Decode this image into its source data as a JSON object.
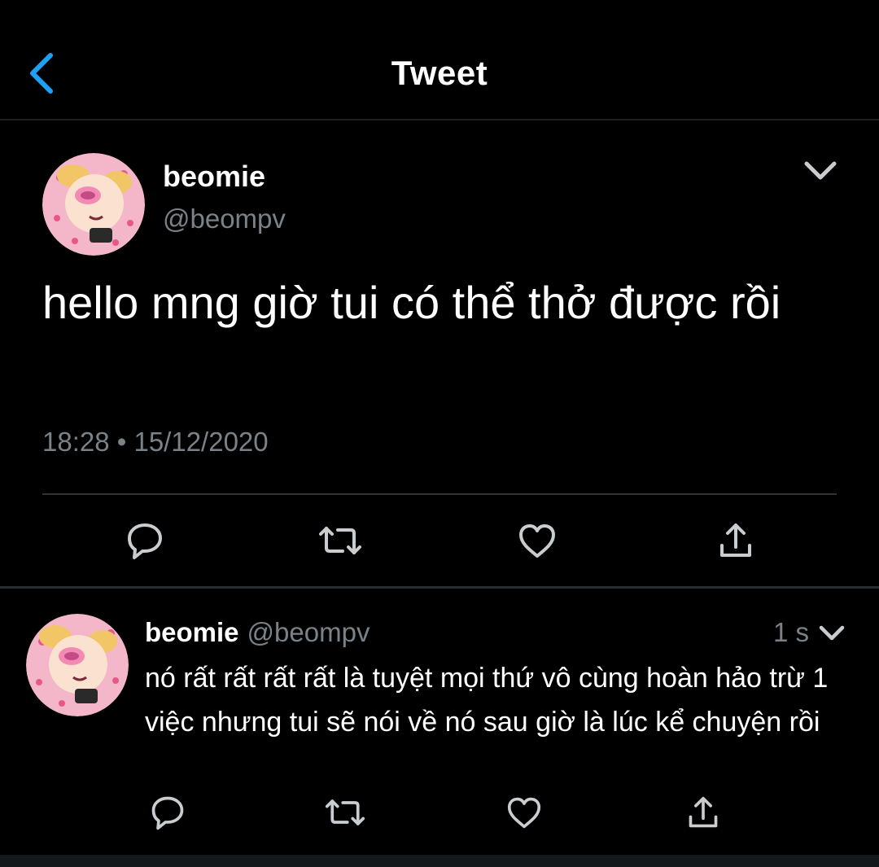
{
  "header": {
    "title": "Tweet",
    "back_icon": "chevron-left-icon",
    "accent_color": "#1da1f2"
  },
  "main_tweet": {
    "author_name": "beomie",
    "author_handle": "@beompv",
    "text": "hello mng giờ tui có thể thở được rồi",
    "timestamp": "18:28 • 15/12/2020",
    "actions": [
      "reply-icon",
      "retweet-icon",
      "like-icon",
      "share-icon"
    ]
  },
  "reply": {
    "author_name": "beomie",
    "author_handle": "@beompv",
    "time_ago": "1 s",
    "text": "nó rất rất rất rất là tuyệt mọi thứ vô cùng hoàn hảo trừ 1 việc nhưng tui sẽ nói về nó sau giờ là lúc kể chuyện rồi",
    "actions": [
      "reply-icon",
      "retweet-icon",
      "like-icon",
      "share-icon"
    ]
  },
  "colors": {
    "background": "#000000",
    "text_primary": "#ffffff",
    "text_secondary": "#7a8288",
    "divider": "#2f3336"
  }
}
